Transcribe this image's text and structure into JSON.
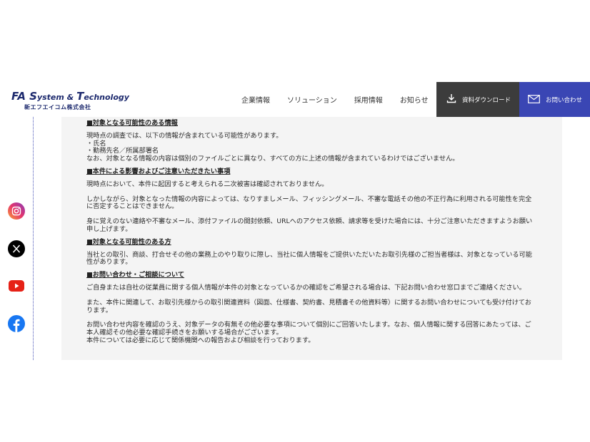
{
  "header": {
    "logo": {
      "main_big1": "FA S",
      "main_rest1": "ystem & ",
      "main_big2": "T",
      "main_rest2": "echnology",
      "sub": "新エフエイコム株式会社"
    },
    "nav": [
      "企業情報",
      "ソリューション",
      "採用情報",
      "お知らせ"
    ],
    "download_label": "資料ダウンロード",
    "contact_label": "お問い合わせ"
  },
  "social": [
    "instagram-icon",
    "x-icon",
    "youtube-icon",
    "facebook-icon"
  ],
  "content": {
    "s1_title": "■対象となる可能性のある情報",
    "s1_l1": "現時点の調査では、以下の情報が含まれている可能性があります。",
    "s1_l2": "・氏名",
    "s1_l3": "・勤務先名／所属部署名",
    "s1_l4": "なお、対象となる情報の内容は個別のファイルごとに異なり、すべての方に上述の情報が含まれているわけではございません。",
    "s2_title": "■本件による影響およびご注意いただきたい事項",
    "s2_l1": "現時点において、本件に起因すると考えられる二次被害は確認されておりません。",
    "s2_l2": "しかしながら、対象となった情報の内容によっては、なりすましメール、フィッシングメール、不審な電話その他の不正行為に利用される可能性を完全に否定することはできません。",
    "s2_l3": "身に覚えのない連絡や不審なメール、添付ファイルの開封依頼、URLへのアクセス依頼、請求等を受けた場合には、十分ご注意いただきますようお願い申し上げます。",
    "s3_title": "■対象となる可能性のある方",
    "s3_l1": "当社との取引、商談、打合せその他の業務上のやり取りに際し、当社に個人情報をご提供いただいたお取引先様のご担当者様は、対象となっている可能性があります。",
    "s4_title": "■お問い合わせ・ご相談について",
    "s4_l1": "ご自身または自社の従業員に関する個人情報が本件の対象となっているかの確認をご希望される場合は、下記お問い合わせ窓口までご連絡ください。",
    "s4_l2": "また、本件に関連して、お取引先様からの取引関連資料（図面、仕様書、契約書、見積書その他資料等）に関するお問い合わせについても受け付けております。",
    "s4_l3": "お問い合わせ内容を確認のうえ、対象データの有無その他必要な事項について個別にご回答いたします。なお、個人情報に関する回答にあたっては、ご本人確認その他必要な確認手続きをお願いする場合がございます。",
    "s4_l4": "本件については必要に応じて関係機関への報告および相談を行っております。"
  },
  "colors": {
    "brand": "#1d2a6e",
    "download_bg": "#3c3c3c",
    "contact_bg": "#3a46b4",
    "panel_bg": "#f4f4f4"
  }
}
